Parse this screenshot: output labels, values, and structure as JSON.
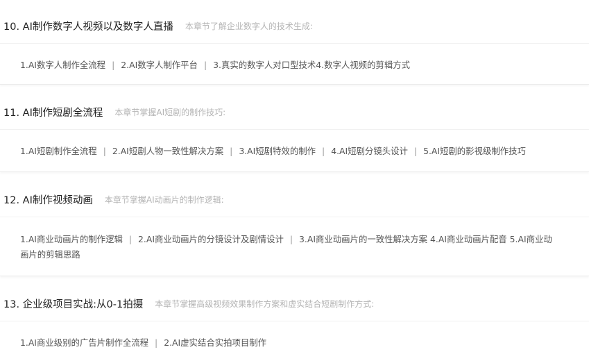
{
  "chapters": [
    {
      "title": "10. AI制作数字人视频以及数字人直播",
      "description": "本章节了解企业数字人的技术生成:",
      "topics": [
        "1.AI数字人制作全流程",
        "2.AI数字人制作平台",
        "3.真实的数字人对口型技术4.数字人视频的剪辑方式"
      ]
    },
    {
      "title": "11. AI制作短剧全流程",
      "description": "本章节掌握AI短剧的制作技巧:",
      "topics": [
        "1.AI短剧制作全流程",
        "2.AI短剧人物一致性解决方案",
        "3.AI短剧特效的制作",
        "4.AI短剧分镜头设计",
        "5.AI短剧的影视级制作技巧"
      ]
    },
    {
      "title": "12. AI制作视频动画",
      "description": "本章节掌握AI动画片的制作逻辑:",
      "topics": [
        "1.AI商业动画片的制作逻辑",
        "2.AI商业动画片的分镜设计及剧情设计",
        "3.AI商业动画片的一致性解决方案 4.AI商业动画片配音 5.AI商业动画片的剪辑思路"
      ]
    },
    {
      "title": "13. 企业级项目实战:从0-1拍摄",
      "description": "本章节掌握高级视频效果制作方案和虚实结合短剧制作方式:",
      "topics": [
        "1.AI商业级别的广告片制作全流程",
        "2.AI虚实结合实拍项目制作"
      ]
    }
  ],
  "separator": "|"
}
